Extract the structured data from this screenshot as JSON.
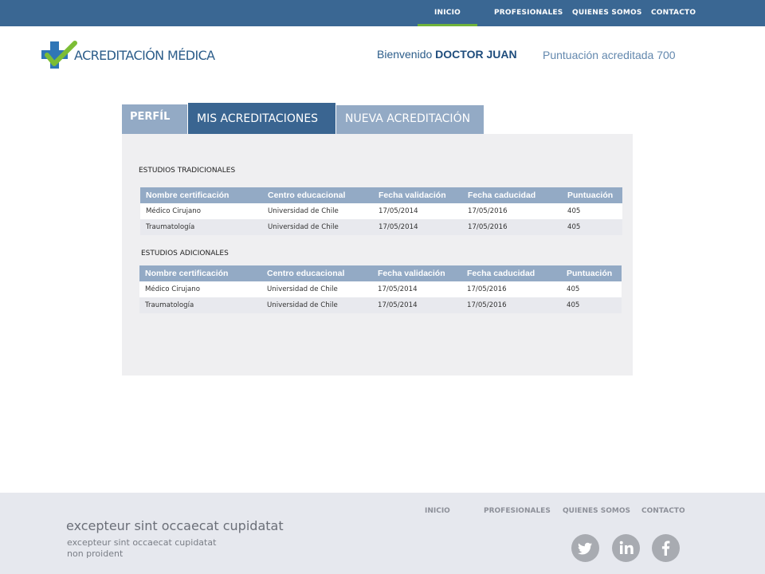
{
  "topnav": {
    "items": [
      {
        "label": "INICIO",
        "active": true
      },
      {
        "label": "PROFESIONALES"
      },
      {
        "label": "QUIENES SOMOS"
      },
      {
        "label": "CONTACTO"
      }
    ]
  },
  "header": {
    "logo_text": "ACREDITACIÓN MÉDICA",
    "welcome_prefix": "Bienvenido",
    "user_name": "DOCTOR JUAN",
    "score_text": "Puntuación acreditada 700"
  },
  "tabs": [
    {
      "label": "PERFÍL"
    },
    {
      "label": "MIS ACREDITACIONES",
      "active": true
    },
    {
      "label": "NUEVA ACREDITACIÓN"
    }
  ],
  "sections": [
    {
      "title": "ESTUDIOS TRADICIONALES",
      "columns": [
        "Nombre certificación",
        "Centro educacional",
        "Fecha validación",
        "Fecha caducidad",
        "Puntuación"
      ],
      "rows": [
        [
          "Médico Cirujano",
          "Universidad de Chile",
          "17/05/2014",
          "17/05/2016",
          "405"
        ],
        [
          "Traumatología",
          "Universidad de Chile",
          "17/05/2014",
          "17/05/2016",
          "405"
        ]
      ]
    },
    {
      "title": "ESTUDIOS ADICIONALES",
      "columns": [
        "Nombre certificación",
        "Centro educacional",
        "Fecha validación",
        "Fecha caducidad",
        "Puntuación"
      ],
      "rows": [
        [
          "Médico Cirujano",
          "Universidad de Chile",
          "17/05/2014",
          "17/05/2016",
          "405"
        ],
        [
          "Traumatología",
          "Universidad de Chile",
          "17/05/2014",
          "17/05/2016",
          "405"
        ]
      ]
    }
  ],
  "footer": {
    "title": "excepteur sint occaecat cupidatat",
    "subtitle": "excepteur sint occaecat cupidatat non proident",
    "nav": [
      "INICIO",
      "PROFESIONALES",
      "QUIENES SOMOS",
      "CONTACTO"
    ],
    "social": [
      "twitter-icon",
      "linkedin-icon",
      "facebook-icon"
    ]
  },
  "colors": {
    "nav_bg": "#3a6793",
    "nav_active_underline": "#6fb23a",
    "tab_active": "#3a6591",
    "tab_inactive": "#93aac5",
    "panel_bg": "#efeff1",
    "footer_bg": "#e6e8ee"
  }
}
